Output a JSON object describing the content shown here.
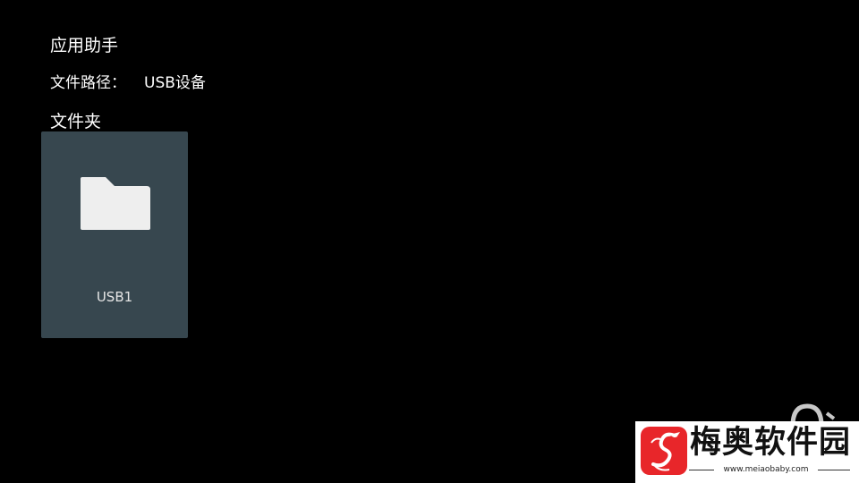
{
  "header": {
    "app_title": "应用助手",
    "path_label": "文件路径：",
    "path_value": "USB设备",
    "section_title": "文件夹"
  },
  "folders": [
    {
      "label": "USB1",
      "icon": "folder-icon"
    }
  ],
  "watermark": {
    "brand": "梅奥软件园",
    "url": "www.meiaobaby.com",
    "logo_icon": "dragon-logo-icon"
  },
  "colors": {
    "background": "#000000",
    "tile": "#37474f",
    "icon": "#eeeeee",
    "text": "#ffffff",
    "logo": "#e8262a"
  }
}
